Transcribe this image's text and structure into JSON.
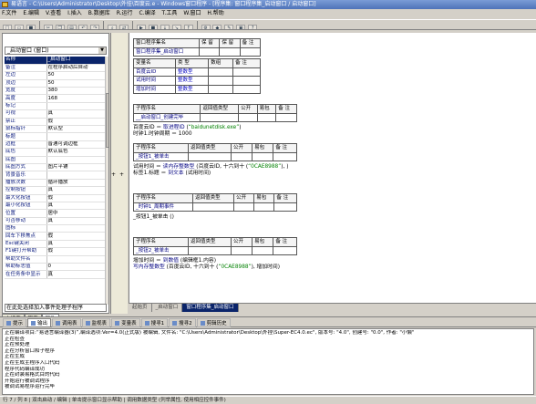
{
  "window": {
    "title": "易语言 - C:\\Users\\Administrator\\Desktop\\外挂\\百度云.e - Windows窗口程序 - [程序集: 窗口程序集_启动窗口 / 启动窗口]"
  },
  "menu": [
    "F.文件",
    "E.编辑",
    "V.查看",
    "I.插入",
    "B.数据库",
    "R.运行",
    "C.编译",
    "T.工具",
    "W.窗口",
    "H.帮助"
  ],
  "property_panel": {
    "combo_value": "_启动窗口 (窗口)",
    "rows": [
      {
        "name": "名称",
        "value": "_启动窗口",
        "selected": true
      },
      {
        "name": "备注",
        "value": "在程序启动后自动"
      },
      {
        "name": "左边",
        "value": "50"
      },
      {
        "name": "顶边",
        "value": "50"
      },
      {
        "name": "宽度",
        "value": "380"
      },
      {
        "name": "高度",
        "value": "168"
      },
      {
        "name": "标记",
        "value": ""
      },
      {
        "name": "可视",
        "value": "真"
      },
      {
        "name": "禁止",
        "value": "假"
      },
      {
        "name": "鼠标指针",
        "value": "默认型"
      },
      {
        "name": "标题",
        "value": ""
      },
      {
        "name": "边框",
        "value": "普通可调边框"
      },
      {
        "name": "底色",
        "value": "默认底色"
      },
      {
        "name": "底图",
        "value": ""
      },
      {
        "name": "底图方式",
        "value": "图片平铺"
      },
      {
        "name": "背景音乐",
        "value": ""
      },
      {
        "name": "播放次数",
        "value": "循环播放"
      },
      {
        "name": "控制按钮",
        "value": "真"
      },
      {
        "name": "最大化按钮",
        "value": "假"
      },
      {
        "name": "最小化按钮",
        "value": "真"
      },
      {
        "name": "位置",
        "value": "居中"
      },
      {
        "name": "可否移动",
        "value": "真"
      },
      {
        "name": "图标",
        "value": ""
      },
      {
        "name": "回车下移焦点",
        "value": "假"
      },
      {
        "name": "Esc键关闭",
        "value": "真"
      },
      {
        "name": "F1键打开帮助",
        "value": "假"
      },
      {
        "name": "帮助文件名",
        "value": ""
      },
      {
        "name": "帮助标志值",
        "value": "0"
      },
      {
        "name": "在任务条中显示",
        "value": "真"
      }
    ],
    "hint": "在此处选择加入事件处理子程序"
  },
  "left_tabs": {
    "support": "支持库",
    "program": "程序",
    "properties": "属性"
  },
  "editor": {
    "assembly_table": {
      "headers": [
        "窗口程序集名",
        "保 留",
        "保 留",
        "备 注"
      ],
      "name": "窗口程序集_启动窗口",
      "var_headers": [
        "变量名",
        "类 型",
        "数组",
        "备 注"
      ],
      "vars": [
        [
          "百度云ID",
          "整数型"
        ],
        [
          "试用时间",
          "整数型"
        ],
        [
          "增加时间",
          "整数型"
        ]
      ]
    },
    "sub1": {
      "headers": [
        "子程序名",
        "返回值类型",
        "公开",
        "易包",
        "备 注"
      ],
      "name": "__启动窗口_创建完毕"
    },
    "sub1_code": [
      [
        {
          "t": "百度云ID ＝ ",
          "c": ""
        },
        {
          "t": "取进程ID",
          "c": "kw"
        },
        {
          "t": " (",
          "c": ""
        },
        {
          "t": "“baidunetdisk.exe”",
          "c": "str"
        },
        {
          "t": ")",
          "c": ""
        }
      ],
      [
        {
          "t": "时钟1.时钟周期 ＝ 1000",
          "c": ""
        }
      ]
    ],
    "sub2": {
      "headers": [
        "子程序名",
        "返回值类型",
        "公开",
        "易包",
        "备 注"
      ],
      "name": "_按钮1_被单击"
    },
    "sub2_code": [
      [
        {
          "t": "试用时间 ＝ ",
          "c": ""
        },
        {
          "t": "读内存整数型",
          "c": "kw"
        },
        {
          "t": " (百度云ID, 十六到十 (",
          "c": ""
        },
        {
          "t": "“0CAE8988”",
          "c": "str"
        },
        {
          "t": "), )",
          "c": ""
        }
      ],
      [
        {
          "t": "标签1.标题 ＝ ",
          "c": ""
        },
        {
          "t": "到文本",
          "c": "kw"
        },
        {
          "t": " (试用时间)",
          "c": ""
        }
      ]
    ],
    "sub3": {
      "headers": [
        "子程序名",
        "返回值类型",
        "公开",
        "易包",
        "备 注"
      ],
      "name": "_时钟1_周期事件"
    },
    "sub3_code": [
      [
        {
          "t": "_按钮1_被单击 ()",
          "c": ""
        }
      ]
    ],
    "sub4": {
      "headers": [
        "子程序名",
        "返回值类型",
        "公开",
        "易包",
        "备 注"
      ],
      "name": "_按钮2_被单击"
    },
    "sub4_code": [
      [
        {
          "t": "增加时间 ＝ ",
          "c": ""
        },
        {
          "t": "到数值",
          "c": "kw"
        },
        {
          "t": " (编辑框1.内容)",
          "c": ""
        }
      ],
      [
        {
          "t": "写内存整数型",
          "c": "kw"
        },
        {
          "t": " (百度云ID, 十六到十 (",
          "c": ""
        },
        {
          "t": "“0CAE8988”",
          "c": "str"
        },
        {
          "t": "), 增加时间)",
          "c": ""
        }
      ]
    ]
  },
  "editor_tabs": [
    "起始页",
    "_启动窗口",
    "窗口程序集_启动窗口"
  ],
  "bottom_tabs": [
    "提示",
    "输出",
    "调用表",
    "监视表",
    "变量表",
    "搜寻1",
    "搜寻2",
    "剪辑历史"
  ],
  "output_lines": [
    "正在编译项目:“易语言编译器(3)”,编译选项:Ver=4.0(正式版) 被编辑, 文件名: \"C:\\Users\\Administrator\\Desktop\\外挂\\Super-EC4.0.ec\", 版本号: \"4.0\", 创建号: \"0.0\", 作者: \"小懒\"",
    "正在检查",
    "正在预处理",
    "正在分析窗口和子程序",
    "正在生成",
    "正在生成主程序入口代码",
    "程序代码编译成功",
    "正在封装易格式目的代码",
    "开始运行被调试程序",
    "被调试易程序运行完毕"
  ],
  "status": "行 7 / 列 8 | 双击启动 / 编辑 | 单击提示窗口显示帮助 | 调用数据类型 (列举属性, 使用相应控件事件)"
}
